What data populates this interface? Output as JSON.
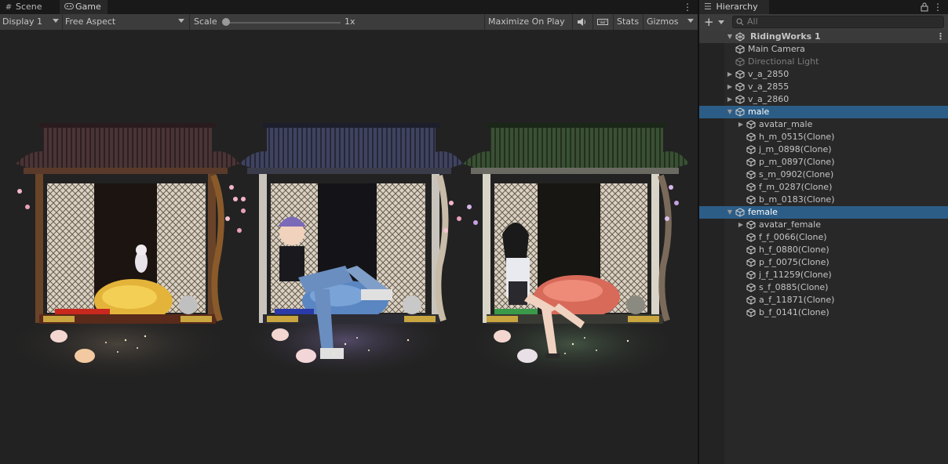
{
  "tabs": [
    {
      "label": "Scene",
      "icon": "hash-icon"
    },
    {
      "label": "Game",
      "icon": "gamepad-icon"
    }
  ],
  "toolbar": {
    "display": "Display 1",
    "aspect": "Free Aspect",
    "scale_label": "Scale",
    "scale_value": "1x",
    "scale_fraction": 0.0,
    "maximize": "Maximize On Play",
    "stats": "Stats",
    "gizmos": "Gizmos"
  },
  "hierarchy": {
    "title": "Hierarchy",
    "search_placeholder": "All",
    "scene": "RidingWorks 1",
    "items": [
      {
        "label": "Main Camera"
      },
      {
        "label": "Directional Light"
      },
      {
        "label": "v_a_2850"
      },
      {
        "label": "v_a_2855"
      },
      {
        "label": "v_a_2860"
      },
      {
        "label": "male"
      },
      {
        "label": "avatar_male"
      },
      {
        "label": "h_m_0515(Clone)"
      },
      {
        "label": "j_m_0898(Clone)"
      },
      {
        "label": "p_m_0897(Clone)"
      },
      {
        "label": "s_m_0902(Clone)"
      },
      {
        "label": "f_m_0287(Clone)"
      },
      {
        "label": "b_m_0183(Clone)"
      },
      {
        "label": "female"
      },
      {
        "label": "avatar_female"
      },
      {
        "label": "f_f_0066(Clone)"
      },
      {
        "label": "h_f_0880(Clone)"
      },
      {
        "label": "p_f_0075(Clone)"
      },
      {
        "label": "j_f_11259(Clone)"
      },
      {
        "label": "s_f_0885(Clone)"
      },
      {
        "label": "a_f_11871(Clone)"
      },
      {
        "label": "b_f_0141(Clone)"
      }
    ]
  },
  "colors": {
    "selection": "#2c5d87",
    "roof_1": "#4a3436",
    "roof_2": "#3a3d55",
    "roof_3": "#33462f"
  }
}
